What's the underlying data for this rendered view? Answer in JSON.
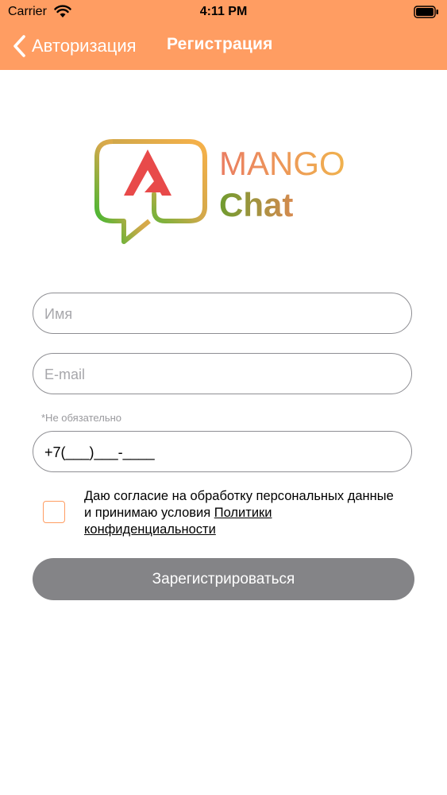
{
  "status_bar": {
    "carrier": "Carrier",
    "time": "4:11 PM"
  },
  "nav": {
    "back_label": "Авторизация",
    "title": "Регистрация"
  },
  "logo": {
    "line1": "MANGO",
    "line2": "Chat"
  },
  "form": {
    "name_placeholder": "Имя",
    "email_placeholder": "E-mail",
    "optional_note": "*Не обязательно",
    "phone_value": "+7(___)___-____"
  },
  "consent": {
    "text": "Даю согласие на обработку персональных данные и принимаю условия ",
    "link": "Политики конфиденциальности",
    "checked": false
  },
  "register_button": "Зарегистрироваться",
  "colors": {
    "accent": "#ff9d62",
    "button": "#848487",
    "border": "#8e8e93"
  }
}
